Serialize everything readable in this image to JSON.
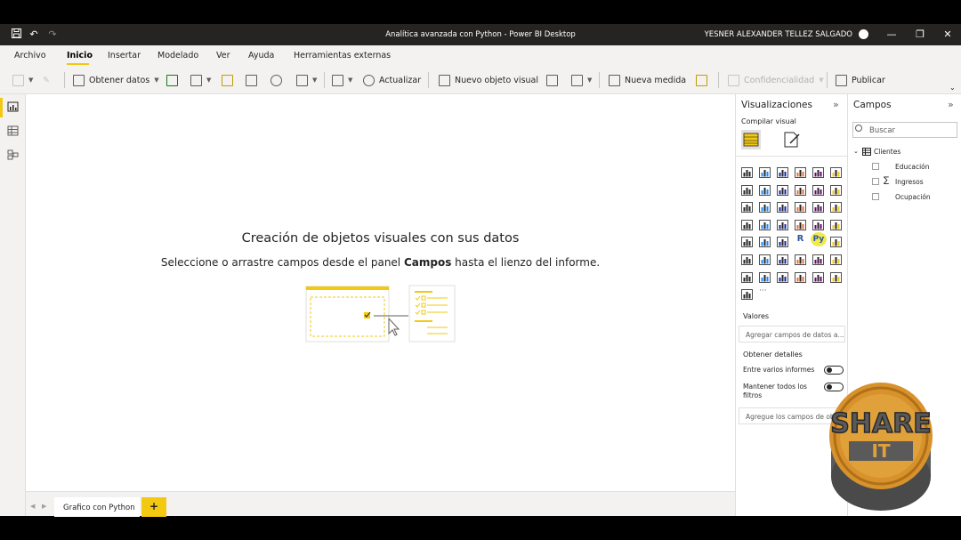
{
  "window": {
    "title": "Analítica avanzada con Python - Power BI Desktop",
    "user": "YESNER ALEXANDER TELLEZ SALGADO"
  },
  "menu": [
    "Archivo",
    "Inicio",
    "Insertar",
    "Modelado",
    "Ver",
    "Ayuda",
    "Herramientas externas"
  ],
  "ribbon": {
    "get_data": "Obtener datos",
    "refresh": "Actualizar",
    "new_visual": "Nuevo objeto visual",
    "new_measure": "Nueva medida",
    "sensitivity": "Confidencialidad",
    "publish": "Publicar"
  },
  "canvas": {
    "title": "Creación de objetos visuales con sus datos",
    "subtitle_pre": "Seleccione o arrastre campos desde el panel ",
    "subtitle_bold": "Campos",
    "subtitle_post": " hasta el lienzo del informe."
  },
  "tabs": {
    "page1": "Grafico con Python",
    "add": "+"
  },
  "visualizations": {
    "title": "Visualizaciones",
    "build_label": "Compilar visual",
    "python_label": "Py",
    "r_label": "R",
    "more": "···",
    "values_label": "Valores",
    "values_placeholder": "Agregar campos de datos a...",
    "drillthrough_label": "Obtener detalles",
    "cross_report": "Entre varios informes",
    "keep_filters": "Mantener todos los filtros",
    "drill_placeholder": "Agregue los campos de obtención de detalles aquí"
  },
  "fields": {
    "title": "Campos",
    "search_placeholder": "Buscar",
    "table": "Clientes",
    "columns": [
      "Educación",
      "Ingresos",
      "Ocupación"
    ],
    "sigma": "∑"
  },
  "watermark": {
    "line1": "SHARE",
    "line2": "IT"
  },
  "colors": {
    "accent": "#f2c811",
    "titlebar": "#252423"
  }
}
